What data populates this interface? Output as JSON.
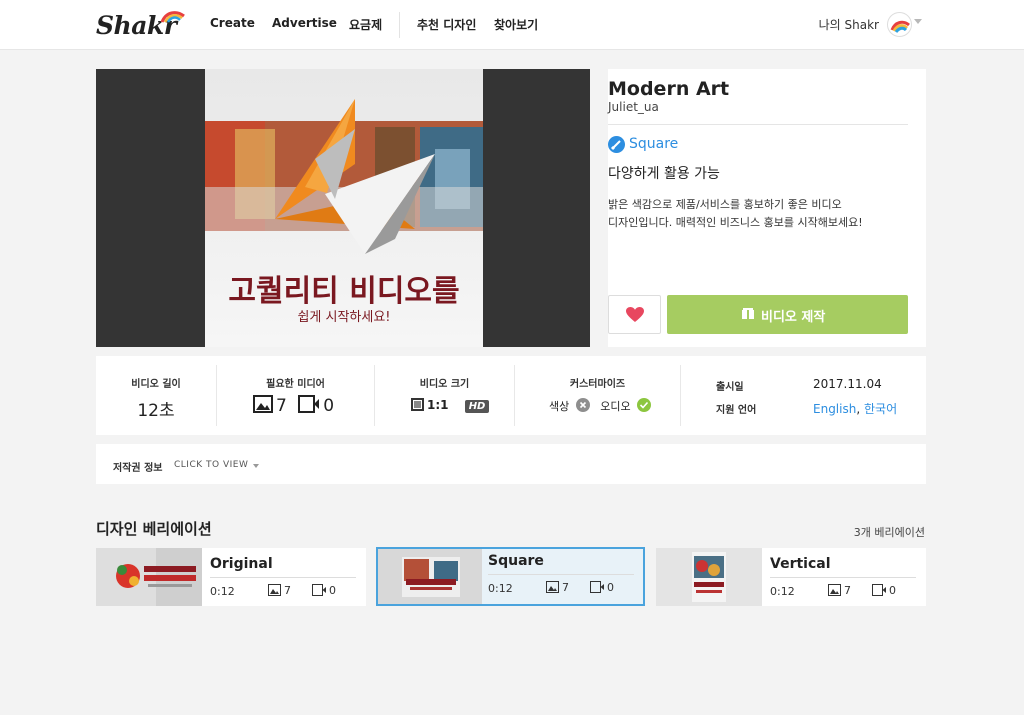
{
  "nav": {
    "logo": "Shakr",
    "links": [
      "Create",
      "Advertise",
      "요금제",
      "추천 디자인",
      "찾아보기"
    ],
    "user_label": "나의 Shakr"
  },
  "hero": {
    "thumbnail_headline": "고퀄리티 비디오를",
    "thumbnail_subline": "쉽게 시작하세요!"
  },
  "info": {
    "title": "Modern Art",
    "author": "Juliet_ua",
    "format_label": "Square",
    "tagline": "다양하게 활용 가능",
    "description_line1": "밝은 색감으로 제품/서비스를 홍보하기 좋은 비디오",
    "description_line2": "디자인입니다. 매력적인 비즈니스 홍보를 시작해보세요!",
    "make_button_label": "비디오 제작",
    "like_icon": "heart-icon",
    "colors": {
      "accent": "#a6cc61",
      "link": "#2d8ee0",
      "heart": "#e8475f"
    }
  },
  "details": {
    "length_label": "비디오 길이",
    "length_value": "12초",
    "media_label": "필요한 미디어",
    "media_images": "7",
    "media_videos": "0",
    "size_label": "비디오 크기",
    "size_ratio": "1:1",
    "size_quality": "HD",
    "custom_label": "커스터마이즈",
    "custom_color": "색상",
    "custom_audio": "오디오",
    "release_key": "출시일",
    "release_value": "2017.11.04",
    "lang_key": "지원 언어",
    "lang_value_1": "English",
    "lang_sep": ",",
    "lang_value_2": "한국어"
  },
  "copyright": {
    "label": "저작권 정보",
    "toggle": "CLICK TO VIEW"
  },
  "variations": {
    "title": "디자인 베리에이션",
    "count": "3개 베리에이션",
    "items": [
      {
        "name": "Original",
        "duration": "0:12",
        "images": "7",
        "videos": "0"
      },
      {
        "name": "Square",
        "duration": "0:12",
        "images": "7",
        "videos": "0"
      },
      {
        "name": "Vertical",
        "duration": "0:12",
        "images": "7",
        "videos": "0"
      }
    ]
  }
}
